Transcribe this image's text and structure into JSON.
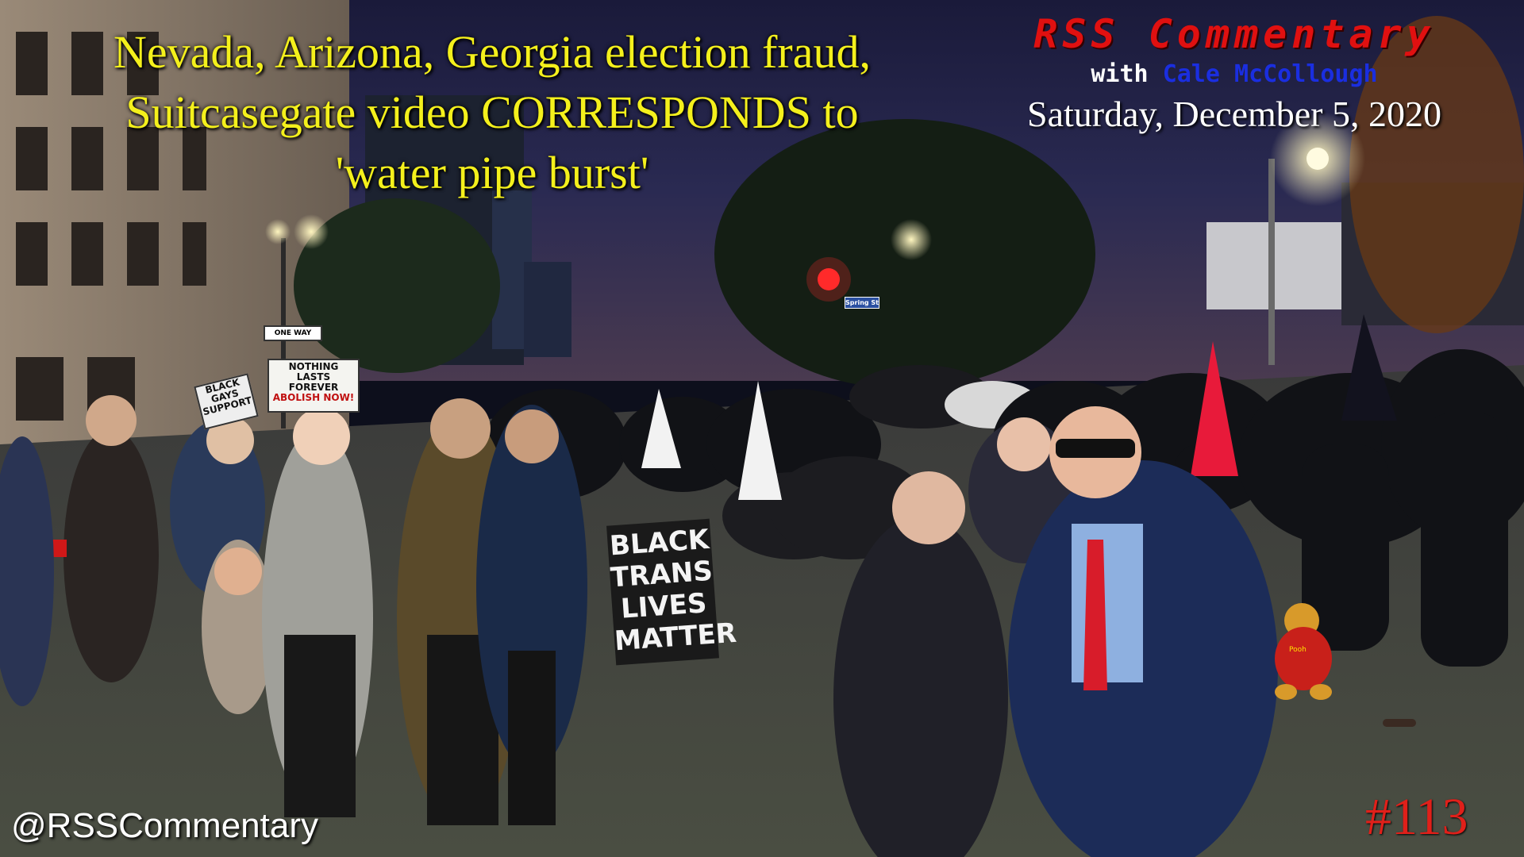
{
  "headline": {
    "line1": "Nevada, Arizona, Georgia election fraud,",
    "line2": "Suitcasegate video CORRESPONDS to",
    "line3": "'water pipe burst'"
  },
  "brand": {
    "title": "RSS Commentary",
    "with": "with",
    "host": "Cale McCollough",
    "date": "Saturday, December 5, 2020"
  },
  "handle": "@RSSCommentary",
  "episode": "#113",
  "signs": {
    "nothing_l1": "NOTHING",
    "nothing_l2": "LASTS",
    "nothing_l3": "FOREVER",
    "nothing_l4": "ABOLISH",
    "nothing_l5": "NOW!",
    "black_sign": "BLACK GAYS SUPPORT",
    "one_way": "ONE WAY",
    "street": "Spring St",
    "banner_l1": "BLACK",
    "banner_l2": "TRANS",
    "banner_l3": "LIVES",
    "banner_l4": "MATTER",
    "pooh": "Pooh"
  },
  "colors": {
    "headline": "#f4f01c",
    "brand_title": "#e01010",
    "host": "#1a2ee0",
    "episode": "#e0201a"
  }
}
